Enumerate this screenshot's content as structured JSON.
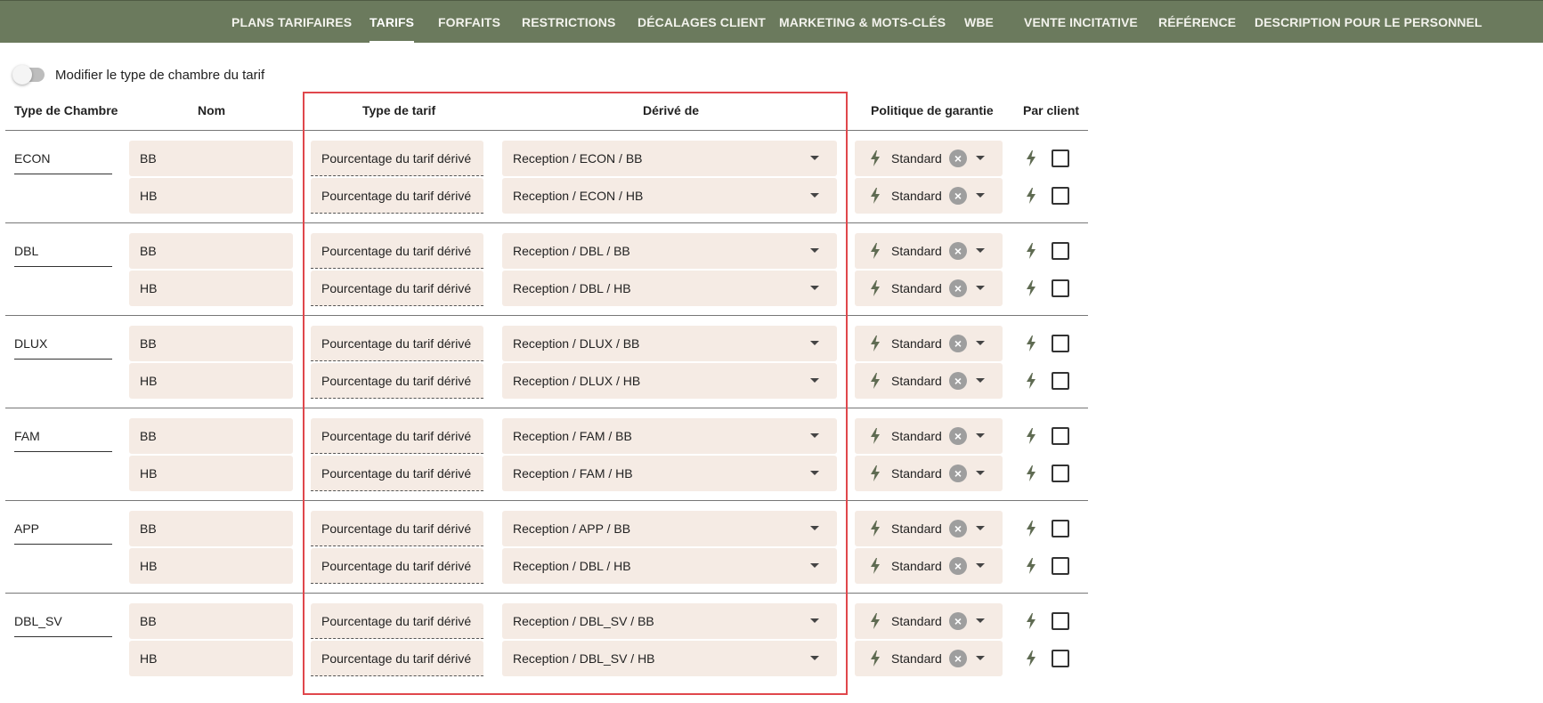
{
  "nav": {
    "items": [
      {
        "label": "PLANS TARIFAIRES",
        "active": false
      },
      {
        "label": "TARIFS",
        "active": true
      },
      {
        "label": "FORFAITS",
        "active": false
      },
      {
        "label": "RESTRICTIONS",
        "active": false
      },
      {
        "label": "DÉCALAGES CLIENT",
        "active": false
      },
      {
        "label": "MARKETING & MOTS-CLÉS",
        "active": false
      },
      {
        "label": "WBE",
        "active": false
      },
      {
        "label": "VENTE INCITATIVE",
        "active": false
      },
      {
        "label": "RÉFÉRENCE",
        "active": false
      },
      {
        "label": "DESCRIPTION POUR LE PERSONNEL",
        "active": false
      }
    ]
  },
  "toggle": {
    "label": "Modifier le type de chambre du tarif",
    "on": false
  },
  "headers": {
    "room_type": "Type de Chambre",
    "name": "Nom",
    "rate_type": "Type de tarif",
    "derived_from": "Dérivé de",
    "guarantee": "Politique de garantie",
    "per_client": "Par client"
  },
  "groups": [
    {
      "room": "ECON",
      "rows": [
        {
          "name": "BB",
          "type": "Pourcentage du tarif dérivé",
          "derived": "Reception / ECON / BB",
          "policy": "Standard",
          "per_client": false
        },
        {
          "name": "HB",
          "type": "Pourcentage du tarif dérivé",
          "derived": "Reception / ECON / HB",
          "policy": "Standard",
          "per_client": false
        }
      ]
    },
    {
      "room": "DBL",
      "rows": [
        {
          "name": "BB",
          "type": "Pourcentage du tarif dérivé",
          "derived": "Reception / DBL / BB",
          "policy": "Standard",
          "per_client": false
        },
        {
          "name": "HB",
          "type": "Pourcentage du tarif dérivé",
          "derived": "Reception / DBL / HB",
          "policy": "Standard",
          "per_client": false
        }
      ]
    },
    {
      "room": "DLUX",
      "rows": [
        {
          "name": "BB",
          "type": "Pourcentage du tarif dérivé",
          "derived": "Reception / DLUX / BB",
          "policy": "Standard",
          "per_client": false
        },
        {
          "name": "HB",
          "type": "Pourcentage du tarif dérivé",
          "derived": "Reception / DLUX / HB",
          "policy": "Standard",
          "per_client": false
        }
      ]
    },
    {
      "room": "FAM",
      "rows": [
        {
          "name": "BB",
          "type": "Pourcentage du tarif dérivé",
          "derived": "Reception / FAM / BB",
          "policy": "Standard",
          "per_client": false
        },
        {
          "name": "HB",
          "type": "Pourcentage du tarif dérivé",
          "derived": "Reception / FAM / HB",
          "policy": "Standard",
          "per_client": false
        }
      ]
    },
    {
      "room": "APP",
      "rows": [
        {
          "name": "BB",
          "type": "Pourcentage du tarif dérivé",
          "derived": "Reception / APP / BB",
          "policy": "Standard",
          "per_client": false
        },
        {
          "name": "HB",
          "type": "Pourcentage du tarif dérivé",
          "derived": "Reception / DBL / HB",
          "policy": "Standard",
          "per_client": false
        }
      ]
    },
    {
      "room": "DBL_SV",
      "rows": [
        {
          "name": "BB",
          "type": "Pourcentage du tarif dérivé",
          "derived": "Reception / DBL_SV / BB",
          "policy": "Standard",
          "per_client": false
        },
        {
          "name": "HB",
          "type": "Pourcentage du tarif dérivé",
          "derived": "Reception / DBL_SV / HB",
          "policy": "Standard",
          "per_client": false
        }
      ]
    }
  ],
  "colors": {
    "nav_bg": "#6b7a5d",
    "field_bg": "#f5ebe4",
    "highlight": "#e0474c",
    "bolt": "#5f6b52"
  }
}
